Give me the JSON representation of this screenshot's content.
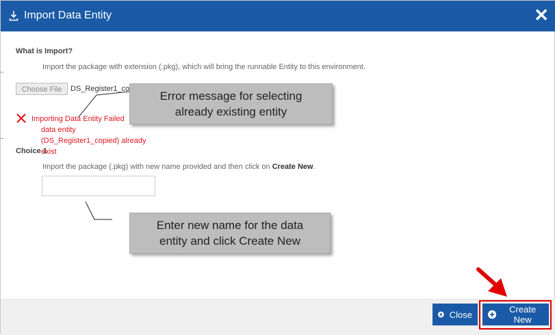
{
  "dialog": {
    "title": "Import Data Entity",
    "close_symbol": "✕",
    "header_color": "#1a5aa6"
  },
  "what_is_import": {
    "heading": "What is Import?",
    "description": "Import the package with extension (.pkg), which will bring the runnable Entity to this environment."
  },
  "file_picker": {
    "button_label": "Choose File",
    "file_name": "DS_Register1_copied.pkg"
  },
  "error": {
    "line1": "Importing Data Entity Failed",
    "line2": "data entity (DS_Register1_copied) already exist",
    "color": "#e0171f",
    "icon": "x-icon"
  },
  "choice1": {
    "heading": "Choice 1",
    "description_prefix": "Import the package (.pkg) with new name provided and then click on ",
    "description_bold": "Create New",
    "description_suffix": ".",
    "name_input_value": "",
    "name_input_placeholder": ""
  },
  "annotations": {
    "callout_error_line1": "Error message for selecting",
    "callout_error_line2": "already existing entity",
    "callout_name_line1": "Enter new name for the data",
    "callout_name_line2": "entity and click Create New",
    "arrow_color": "#e00000"
  },
  "footer": {
    "close_label": "Close",
    "create_label": "Create New",
    "close_icon": "circle-x-icon",
    "create_icon": "circle-plus-icon"
  }
}
